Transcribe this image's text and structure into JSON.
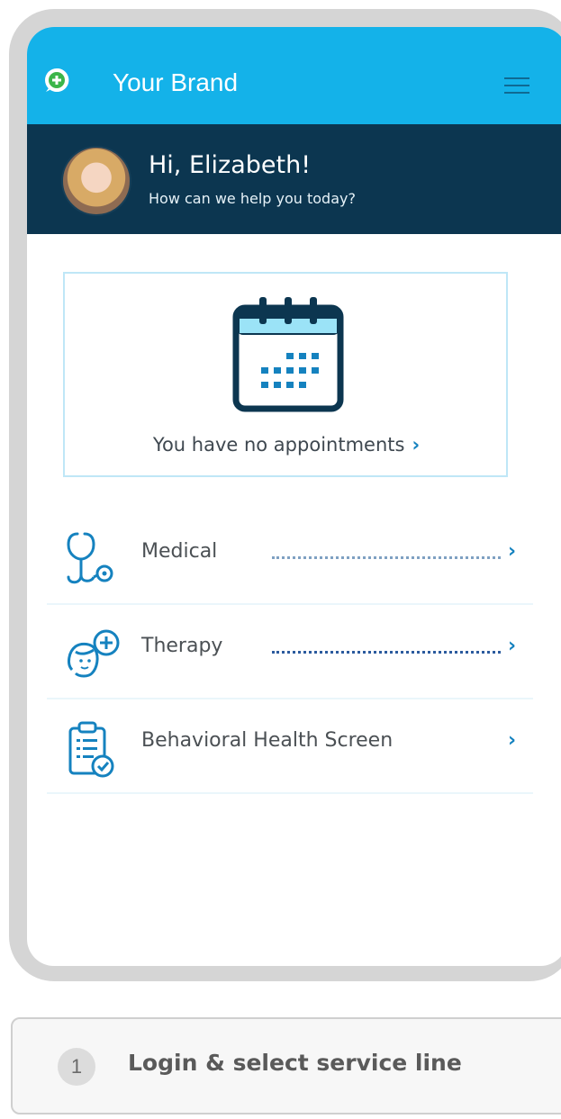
{
  "header": {
    "brand_name": "Your Brand",
    "accent_color": "#14b2e9",
    "logo_icon": "plus-chat-icon",
    "menu_icon": "hamburger-menu-icon"
  },
  "greeting": {
    "title": "Hi, Elizabeth!",
    "subtitle": "How can we help you today?",
    "band_color": "#0c3650"
  },
  "appointments": {
    "message": "You have no appointments",
    "chevron": "›",
    "icon": "calendar-icon"
  },
  "services": [
    {
      "label": "Medical",
      "icon": "stethoscope-icon",
      "chevron": "›"
    },
    {
      "label": "Therapy",
      "icon": "therapy-head-icon",
      "chevron": "›"
    },
    {
      "label": "Behavioral Health Screen",
      "icon": "clipboard-check-icon",
      "chevron": "›"
    }
  ],
  "step": {
    "number": "1",
    "label": "Login & select service line"
  }
}
